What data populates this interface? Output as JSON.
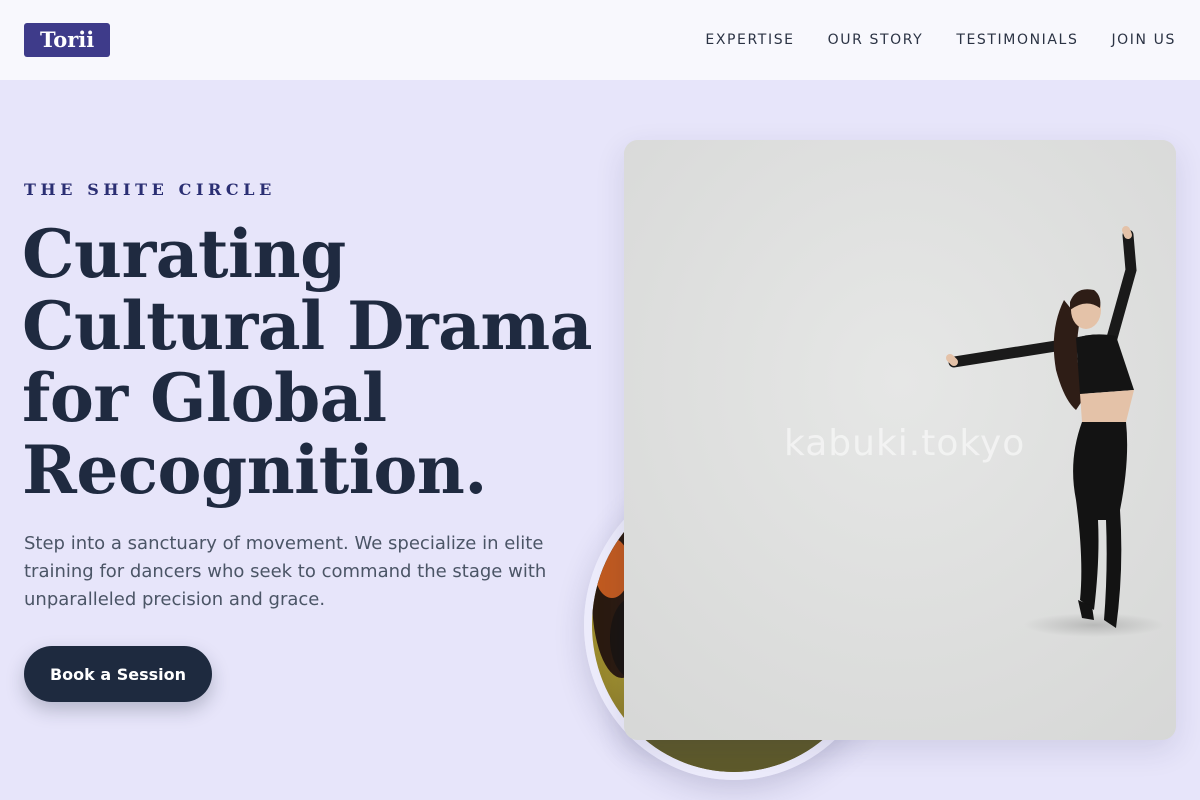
{
  "logo": {
    "text": "Torii"
  },
  "nav": {
    "items": [
      {
        "label": "EXPERTISE"
      },
      {
        "label": "OUR STORY"
      },
      {
        "label": "TESTIMONIALS"
      },
      {
        "label": "JOIN US"
      }
    ]
  },
  "hero": {
    "eyebrow": "THE SHITE CIRCLE",
    "headline_lines": [
      "Curating",
      "Cultural Drama",
      "for Global",
      "Recognition."
    ],
    "subtext": "Step into a sanctuary of movement. We specialize in elite training for dancers who seek to command the stage with unparalleled precision and grace.",
    "cta_label": "Book a Session",
    "photo_watermark": "kabuki.tokyo"
  },
  "colors": {
    "page_bg": "#e7e5fa",
    "navbar_bg": "#f8f8fd",
    "logo_bg": "#3e3b8a",
    "headline": "#1f2a40",
    "eyebrow": "#2b2f73",
    "cta_bg": "#1e2a3f"
  }
}
